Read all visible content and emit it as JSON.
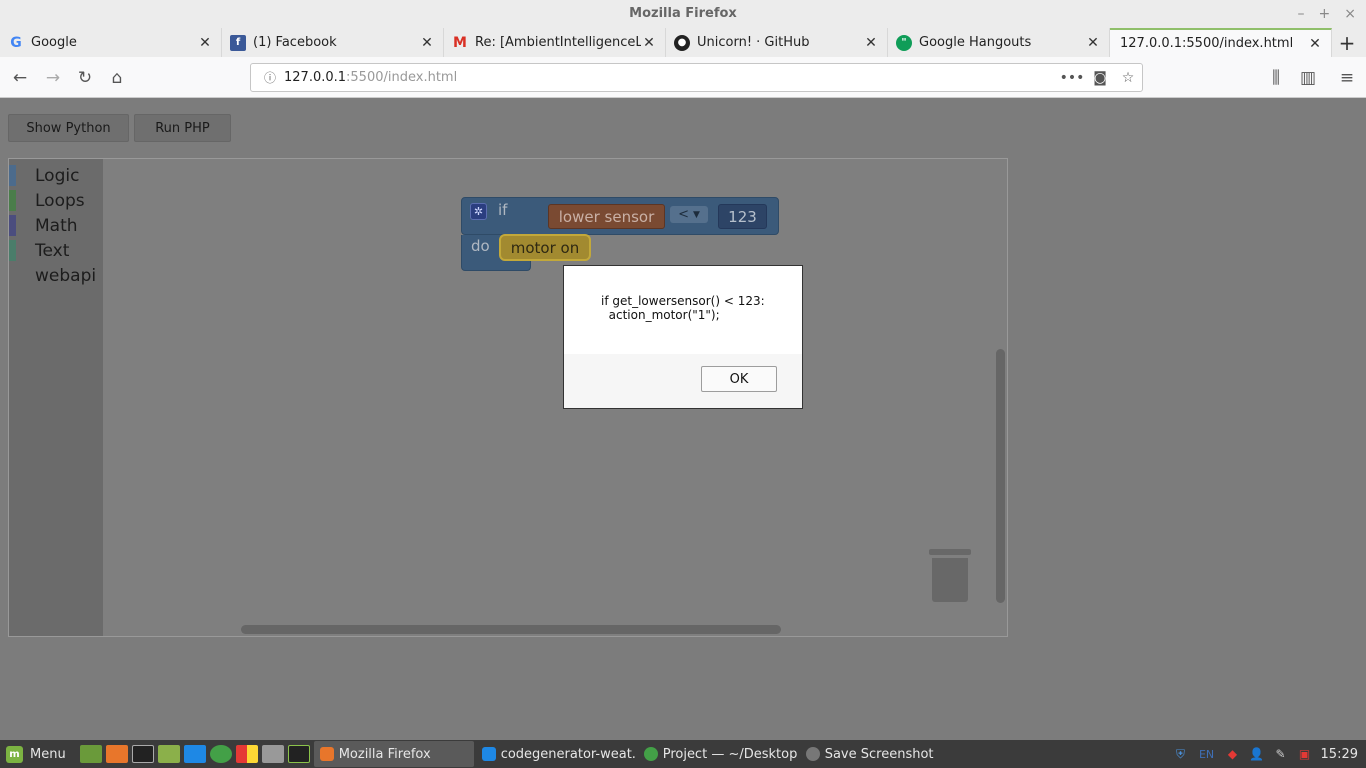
{
  "window": {
    "title": "Mozilla Firefox"
  },
  "tabs": [
    {
      "label": "Google",
      "icon": "google-icon",
      "active": false
    },
    {
      "label": "(1) Facebook",
      "icon": "facebook-icon",
      "active": false
    },
    {
      "label": "Re: [AmbientIntelligenceLab/",
      "icon": "gmail-icon",
      "active": false
    },
    {
      "label": "Unicorn! · GitHub",
      "icon": "github-icon",
      "active": false
    },
    {
      "label": "Google Hangouts",
      "icon": "hangouts-icon",
      "active": false
    },
    {
      "label": "127.0.0.1:5500/index.html",
      "icon": "none",
      "active": true
    }
  ],
  "url": {
    "host": "127.0.0.1",
    "rest": ":5500/index.html"
  },
  "buttons": {
    "show_python": "Show Python",
    "run_php": "Run PHP"
  },
  "toolbox": [
    {
      "label": "Logic",
      "color": "#4c6b8c"
    },
    {
      "label": "Loops",
      "color": "#4a7d4a"
    },
    {
      "label": "Math",
      "color": "#4b4d7e"
    },
    {
      "label": "Text",
      "color": "#4a7d6a"
    },
    {
      "label": "webapi",
      "color": ""
    }
  ],
  "blocks": {
    "if_label": "if",
    "do_label": "do",
    "sensor": "lower sensor",
    "operator": "<",
    "number": "123",
    "action": "motor on"
  },
  "dialog": {
    "line1": "if get_lowersensor() < 123:",
    "line2": "  action_motor(\"1\");",
    "ok": "OK"
  },
  "taskbar": {
    "menu": "Menu",
    "tasks": [
      "Mozilla Firefox",
      "codegenerator-weat...",
      "Project — ~/Desktop...",
      "Save Screenshot"
    ],
    "lang": "EN",
    "clock": "15:29"
  }
}
